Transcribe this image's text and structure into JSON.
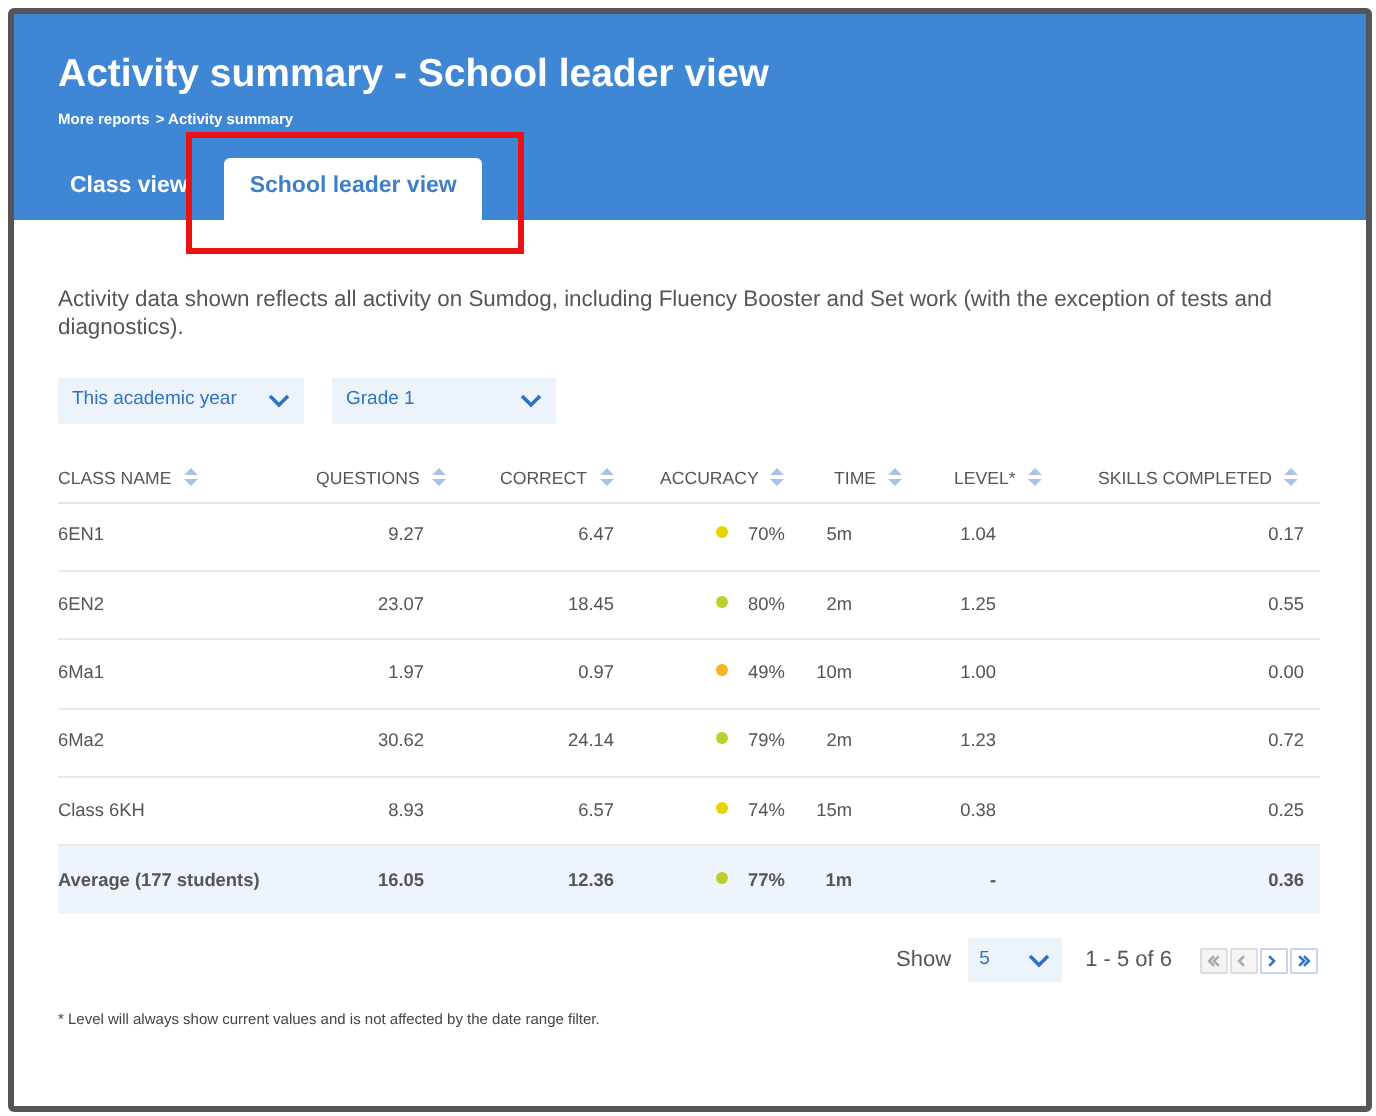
{
  "header": {
    "title": "Activity summary - School leader view",
    "breadcrumb": {
      "link": "More reports",
      "current": "> Activity summary"
    }
  },
  "tabs": [
    {
      "label": "Class view",
      "selected": false,
      "highlighted": false
    },
    {
      "label": "School leader view",
      "selected": true,
      "highlighted": true
    }
  ],
  "description": "Activity data shown reflects all activity on Sumdog, including Fluency Booster and Set work (with the exception of tests and diagnostics).",
  "filters": [
    {
      "value": "This academic year"
    },
    {
      "value": "Grade 1"
    }
  ],
  "table": {
    "columns": [
      "CLASS NAME",
      "QUESTIONS",
      "CORRECT",
      "ACCURACY",
      "TIME",
      "LEVEL*",
      "SKILLS COMPLETED"
    ],
    "rows": [
      {
        "cells": [
          "6EN1",
          "9.27",
          "6.47",
          "70%",
          "5m",
          "1.04",
          "0.17"
        ],
        "color": "#e8d500",
        "summary": false
      },
      {
        "cells": [
          "6EN2",
          "23.07",
          "18.45",
          "80%",
          "2m",
          "1.25",
          "0.55"
        ],
        "color": "#bccf2f",
        "summary": false
      },
      {
        "cells": [
          "6Ma1",
          "1.97",
          "0.97",
          "49%",
          "10m",
          "1.00",
          "0.00"
        ],
        "color": "#f6b31b",
        "summary": false
      },
      {
        "cells": [
          "6Ma2",
          "30.62",
          "24.14",
          "79%",
          "2m",
          "1.23",
          "0.72"
        ],
        "color": "#bccf2f",
        "summary": false
      },
      {
        "cells": [
          "Class 6KH",
          "8.93",
          "6.57",
          "74%",
          "15m",
          "0.38",
          "0.25"
        ],
        "color": "#e8d500",
        "summary": false
      },
      {
        "cells": [
          "Average (177 students)",
          "16.05",
          "12.36",
          "77%",
          "1m",
          "-",
          "0.36"
        ],
        "color": "#bccf2f",
        "summary": true
      }
    ]
  },
  "pagination": {
    "show_label": "Show",
    "page_size": "5",
    "range": "1 - 5 of 6",
    "buttons": [
      {
        "kind": "first",
        "disabled": true
      },
      {
        "kind": "prev",
        "disabled": true
      },
      {
        "kind": "next",
        "disabled": false
      },
      {
        "kind": "last",
        "disabled": false
      }
    ]
  },
  "footnote": "* Level will always show current values and is not affected by the date range filter."
}
